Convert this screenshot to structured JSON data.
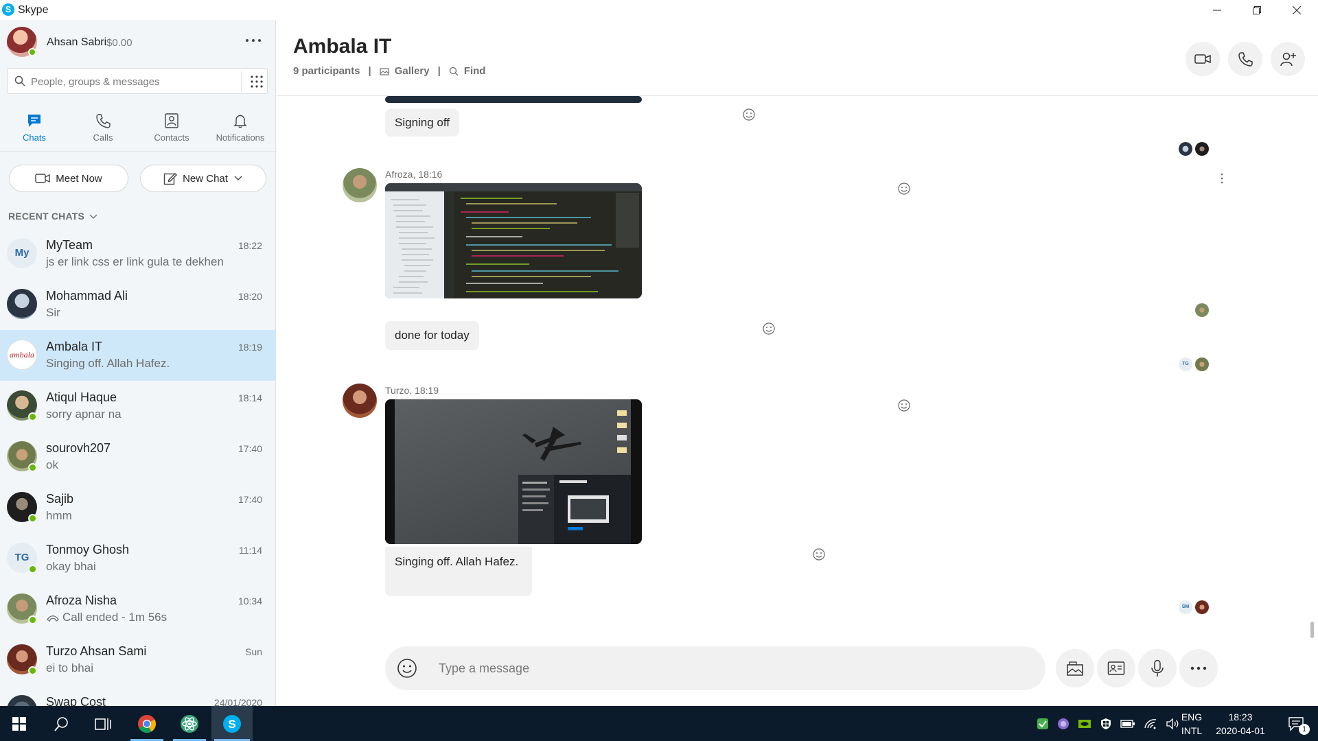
{
  "window": {
    "title": "Skype",
    "controls": [
      "minimize",
      "restore",
      "close"
    ]
  },
  "profile": {
    "name": "Ahsan Sabri",
    "credit": "$0.00",
    "status": "online"
  },
  "search": {
    "placeholder": "People, groups & messages",
    "value": ""
  },
  "nav": {
    "tabs": [
      {
        "label": "Chats",
        "icon": "chat-icon",
        "active": true
      },
      {
        "label": "Calls",
        "icon": "phone-icon",
        "active": false
      },
      {
        "label": "Contacts",
        "icon": "contacts-icon",
        "active": false
      },
      {
        "label": "Notifications",
        "icon": "bell-icon",
        "active": false
      }
    ]
  },
  "actions": {
    "meet_now": "Meet Now",
    "new_chat": "New Chat"
  },
  "recent": {
    "header": "RECENT CHATS",
    "chats": [
      {
        "name": "MyTeam",
        "message": "js er link css er link gula te dekhen",
        "time": "18:22",
        "initials": "My",
        "online": false
      },
      {
        "name": "Mohammad  Ali",
        "message": "Sir",
        "time": "18:20",
        "online": false
      },
      {
        "name": "Ambala IT",
        "message": "Singing off. Allah Hafez.",
        "time": "18:19",
        "online": false,
        "active": true
      },
      {
        "name": "Atiqul Haque",
        "message": "sorry apnar na",
        "time": "18:14",
        "online": true
      },
      {
        "name": "sourovh207",
        "message": "ok",
        "time": "17:40",
        "online": true
      },
      {
        "name": "Sajib",
        "message": "hmm",
        "time": "17:40",
        "online": true
      },
      {
        "name": "Tonmoy Ghosh",
        "message": "okay bhai",
        "time": "11:14",
        "initials": "TG",
        "online": true
      },
      {
        "name": "Afroza Nisha",
        "message": "Call ended - 1m 56s",
        "time": "10:34",
        "online": true
      },
      {
        "name": "Turzo Ahsan Sami",
        "message": "ei to bhai",
        "time": "Sun",
        "online": true
      },
      {
        "name": "Swap Cost",
        "message": "",
        "time": "24/01/2020",
        "online": false
      }
    ]
  },
  "conversation": {
    "title": "Ambala IT",
    "participants": "9 participants",
    "gallery": "Gallery",
    "find": "Find",
    "messages": [
      {
        "text": "Signing off"
      },
      {
        "author": "Afroza, 18:16",
        "image": "code-editor-screenshot"
      },
      {
        "text": "done for today"
      },
      {
        "author": "Turzo, 18:19",
        "image": "airplane-screenshot"
      },
      {
        "text": "Singing off. Allah Hafez."
      }
    ],
    "seen_initials": [
      "TG",
      "SM"
    ],
    "composer_placeholder": "Type a message"
  },
  "taskbar": {
    "language": "ENG",
    "layout": "INTL",
    "time": "18:23",
    "date": "2020-04-01",
    "notification_count": "1"
  },
  "colors": {
    "accent": "#0078d4",
    "skype_blue": "#00aff0",
    "sidebar_bg": "#f2f6f9",
    "active_row": "#cfe8f9",
    "presence": "#6bb700",
    "taskbar": "#0b1b2b"
  }
}
